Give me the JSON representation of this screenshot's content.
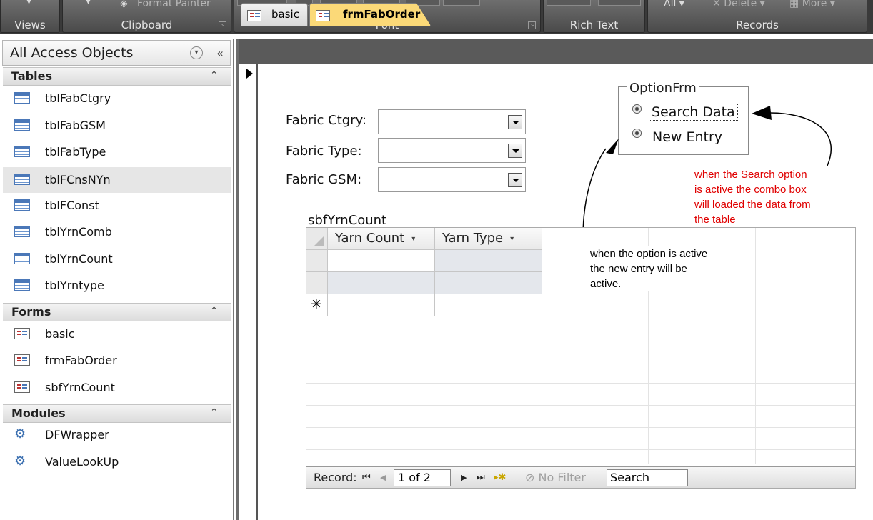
{
  "ribbon": {
    "groups": [
      {
        "title": "Views"
      },
      {
        "title": "Clipboard",
        "top_text": "Format Painter"
      },
      {
        "title": "Font"
      },
      {
        "title": "Rich Text"
      },
      {
        "title": "Records",
        "top_text_1": "All ▾",
        "top_text_2": "Delete ▾",
        "top_text_3": "More ▾"
      }
    ]
  },
  "nav": {
    "title": "All Access Objects",
    "sections": [
      {
        "name": "Tables",
        "items": [
          "tblFabCtgry",
          "tblFabGSM",
          "tblFabType",
          "tblFCnsNYn",
          "tblFConst",
          "tblYrnComb",
          "tblYrnCount",
          "tblYrntype"
        ]
      },
      {
        "name": "Forms",
        "items": [
          "basic",
          "frmFabOrder",
          "sbfYrnCount"
        ]
      },
      {
        "name": "Modules",
        "items": [
          "DFWrapper",
          "ValueLookUp"
        ]
      }
    ]
  },
  "tabs": [
    {
      "label": "basic"
    },
    {
      "label": "frmFabOrder"
    }
  ],
  "form": {
    "fabric_ctgry_label": "Fabric Ctgry:",
    "fabric_type_label": "Fabric Type:",
    "fabric_gsm_label": "Fabric GSM:",
    "option_frame_title": "OptionFrm",
    "option_search": "Search Data",
    "option_new": "New Entry"
  },
  "annotations": {
    "search_note": [
      "when  the Search  option",
      "is  active the combo box",
      "will loaded  the data  from",
      "the table"
    ],
    "new_note": [
      "when the option  is active",
      "the  new entry will be",
      "active."
    ],
    "colors": {
      "search_note": "#e00000",
      "new_note": "#000000"
    }
  },
  "subform": {
    "title": "sbfYrnCount",
    "columns": [
      "Yarn Count",
      "Yarn Type"
    ],
    "navbar": {
      "record_label": "Record:",
      "record_value": "1 of 2",
      "filter_label": "No Filter",
      "search_value": "Search"
    }
  }
}
